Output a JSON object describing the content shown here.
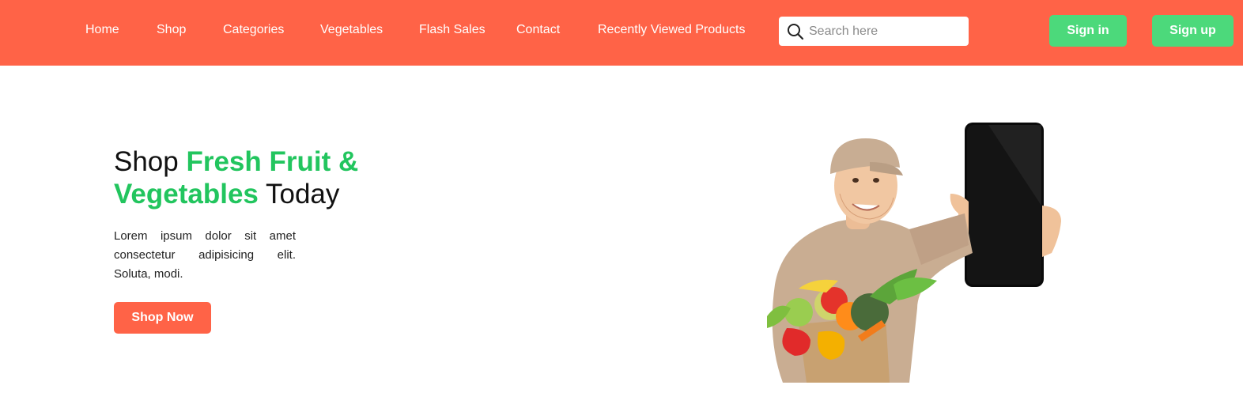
{
  "nav": {
    "links": [
      "Home",
      "Shop",
      "Categories",
      "Vegetables",
      "Flash Sales",
      "Contact",
      "Recently Viewed Products"
    ]
  },
  "search": {
    "placeholder": "Search here",
    "value": ""
  },
  "auth": {
    "signin_label": "Sign in",
    "signup_label": "Sign up"
  },
  "hero": {
    "title_part1": "Shop ",
    "title_accent": "Fresh Fruit & Vegetables",
    "title_part2": " Today",
    "description": "Lorem ipsum dolor sit amet consectetur adipisicing elit. Soluta, modi.",
    "cta_label": "Shop Now",
    "image_icon": "delivery-man-with-phone-and-groceries"
  },
  "colors": {
    "primary": "#ff6347",
    "accent_green": "#22c55e",
    "button_green": "#4cd97b",
    "nav_text": "#ffffff"
  }
}
